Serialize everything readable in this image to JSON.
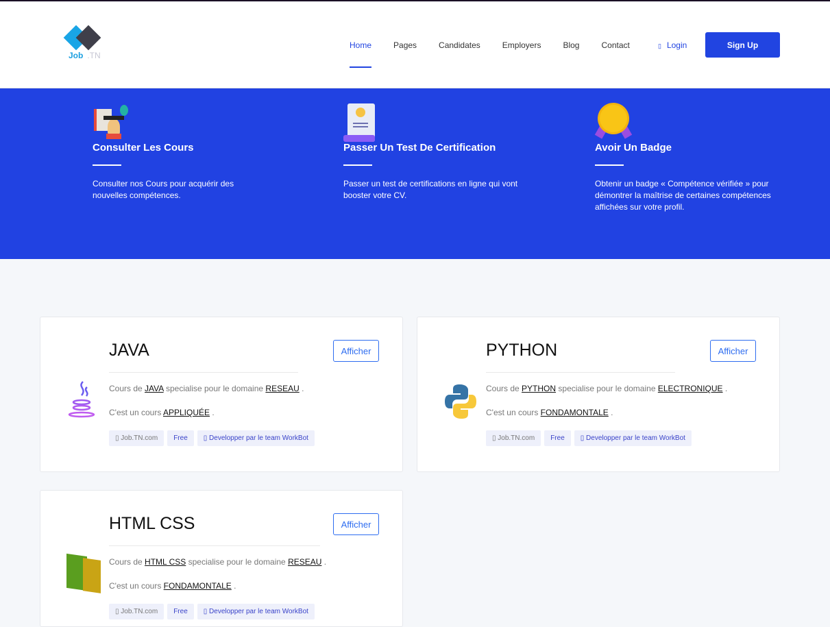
{
  "header": {
    "logo_text_1": "Job",
    "logo_text_2": ".TN",
    "nav": [
      "Home",
      "Pages",
      "Candidates",
      "Employers",
      "Blog",
      "Contact"
    ],
    "login": "Login",
    "signup": "Sign Up"
  },
  "features": [
    {
      "title": "Consulter Les Cours",
      "text": "Consulter nos Cours pour acquérir des nouvelles compétences."
    },
    {
      "title": "Passer Un Test De Certification",
      "text": "Passer un test de certifications en ligne qui vont booster votre CV."
    },
    {
      "title": "Avoir Un Badge",
      "text": "Obtenir un badge « Compétence vérifiée » pour démontrer la maîtrise de certaines compétences affichées sur votre profil."
    }
  ],
  "courses": [
    {
      "title": "JAVA",
      "button": "Afficher",
      "p1a": "Cours de",
      "lang": "JAVA",
      "p1b": "specialise pour le domaine",
      "domain": "RESEAU",
      "p2a": "C'est un cours",
      "type": "APPLIQUÉE",
      "dot": ".",
      "tag1": "Job.TN.com",
      "tag2": "Free",
      "tag3": "Developper par le team WorkBot"
    },
    {
      "title": "PYTHON",
      "button": "Afficher",
      "p1a": "Cours de",
      "lang": "PYTHON",
      "p1b": "specialise pour le domaine",
      "domain": "ELECTRONIQUE",
      "p2a": "C'est un cours",
      "type": "FONDAMONTALE",
      "dot": ".",
      "tag1": "Job.TN.com",
      "tag2": "Free",
      "tag3": "Developper par le team WorkBot"
    },
    {
      "title": "HTML CSS",
      "button": "Afficher",
      "p1a": "Cours de",
      "lang": "HTML CSS",
      "p1b": "specialise pour le domaine",
      "domain": "RESEAU",
      "p2a": "C'est un cours",
      "type": "FONDAMONTALE",
      "dot": ".",
      "tag1": "Job.TN.com",
      "tag2": "Free",
      "tag3": "Developper par le team WorkBot"
    }
  ]
}
